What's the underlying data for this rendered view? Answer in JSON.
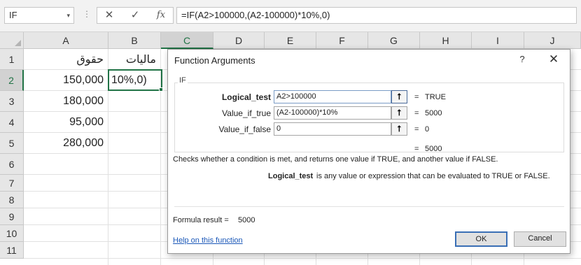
{
  "formula_bar": {
    "name_box": "IF",
    "name_box_arrow": "▾",
    "dots": "⋮",
    "cancel_glyph": "✕",
    "enter_glyph": "✓",
    "fx_glyph": "fx",
    "formula": "=IF(A2>100000,(A2-100000)*10%,0)"
  },
  "sheet": {
    "columns": [
      "A",
      "B",
      "C",
      "D",
      "E",
      "F",
      "G",
      "H",
      "I",
      "J"
    ],
    "selected_column": "C",
    "rows": [
      "1",
      "2",
      "3",
      "4",
      "5",
      "6",
      "7",
      "8",
      "9",
      "10",
      "11"
    ],
    "selected_row": "2",
    "cells": {
      "A1": "حقوق",
      "B1": "مالیات",
      "A2": "150,000",
      "B2": "10%,0)",
      "A3": "180,000",
      "A4": "95,000",
      "A5": "280,000"
    }
  },
  "dialog": {
    "title": "Function Arguments",
    "help_glyph": "?",
    "close_glyph": "✕",
    "group_label": "IF",
    "args": [
      {
        "label": "Logical_test",
        "value": "A2>100000",
        "result": "TRUE"
      },
      {
        "label": "Value_if_true",
        "value": "(A2-100000)*10%",
        "result": "5000"
      },
      {
        "label": "Value_if_false",
        "value": "0",
        "result": "0"
      }
    ],
    "collapse_glyph": "⭡",
    "equals": "=",
    "overall_result": "5000",
    "description": "Checks whether a condition is met, and returns one value if TRUE, and another value if FALSE.",
    "arg_desc_name": "Logical_test",
    "arg_desc_text": "is any value or expression that can be evaluated to TRUE or FALSE.",
    "formula_result_label": "Formula result =",
    "formula_result_value": "5000",
    "help_link": "Help on this function",
    "ok_label": "OK",
    "cancel_label": "Cancel"
  },
  "colors": {
    "accent_green": "#217346",
    "link_blue": "#1b58b8",
    "ok_border": "#3a6fb5"
  }
}
